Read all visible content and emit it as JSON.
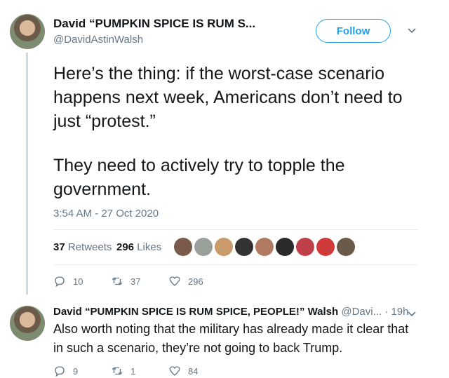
{
  "tweet": {
    "display_name": "David “PUMPKIN SPICE IS RUM S...",
    "handle": "@DavidAstinWalsh",
    "follow_label": "Follow",
    "text_p1": "Here’s the thing: if the worst-case scenario happens next week, Americans don’t need to just “protest.”",
    "text_p2": "They need to actively try to topple the government.",
    "timestamp": "3:54 AM - 27 Oct 2020",
    "retweets_count": "37",
    "retweets_label": "Retweets",
    "likes_count": "296",
    "likes_label": "Likes",
    "likers": [
      "#7a5a4a",
      "#9aa09a",
      "#c99a6a",
      "#333333",
      "#b07a60",
      "#2a2a2a",
      "#c0404a",
      "#d03a3a",
      "#6a5a4a"
    ],
    "reply_count": "10",
    "retweet_count_action": "37",
    "like_count_action": "296"
  },
  "reply": {
    "display_name": "David “PUMPKIN SPICE IS RUM SPICE, PEOPLE!” Walsh",
    "handle": "@Davi...",
    "separator": "·",
    "time": "19h",
    "text": "Also worth noting that the military has already made it clear that in such a scenario, they’re not going to back Trump.",
    "reply_count": "9",
    "retweet_count": "1",
    "like_count": "84"
  },
  "colors": {
    "accent": "#1da1f2",
    "muted": "#657786",
    "text": "#14171a"
  }
}
